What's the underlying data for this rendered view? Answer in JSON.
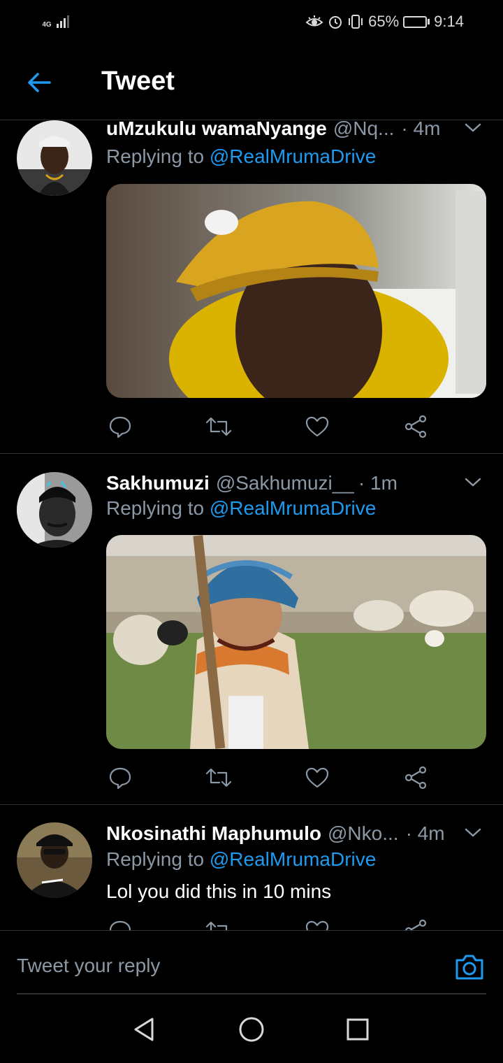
{
  "status_bar": {
    "network": "4G",
    "battery_percent_label": "65%",
    "battery_level": 0.65,
    "time": "9:14",
    "icons": [
      "eye-comfort-icon",
      "alarm-icon",
      "vibrate-icon"
    ]
  },
  "header": {
    "title": "Tweet",
    "back_icon": "arrow-left-icon"
  },
  "tweets": [
    {
      "name": "uMzukulu wamaNyange",
      "handle": "@Nq...",
      "time": "· 4m",
      "replying_prefix": "Replying to",
      "replying_to": "@RealMrumaDrive",
      "text": "",
      "has_media": true,
      "media_desc": "man-in-yellow-cap-photo"
    },
    {
      "name": "Sakhumuzi",
      "handle": "@Sakhumuzi__",
      "time": "· 1m",
      "replying_prefix": "Replying to",
      "replying_to": "@RealMrumaDrive",
      "text": "",
      "has_media": true,
      "media_desc": "laughing-child-with-sheep-photo"
    },
    {
      "name": "Nkosinathi Maphumulo",
      "handle": "@Nko...",
      "time": "· 4m",
      "replying_prefix": "Replying to",
      "replying_to": "@RealMrumaDrive",
      "text": "Lol you did this in 10 mins",
      "has_media": false
    }
  ],
  "reply": {
    "placeholder": "Tweet your reply",
    "camera_icon": "camera-icon"
  },
  "nav": {
    "back_icon": "nav-back-icon",
    "home_icon": "nav-home-icon",
    "recents_icon": "nav-recents-icon"
  },
  "colors": {
    "background": "#000000",
    "accent": "#1d9bf0",
    "secondary_text": "#8b98a5",
    "divider": "#2f3336"
  }
}
